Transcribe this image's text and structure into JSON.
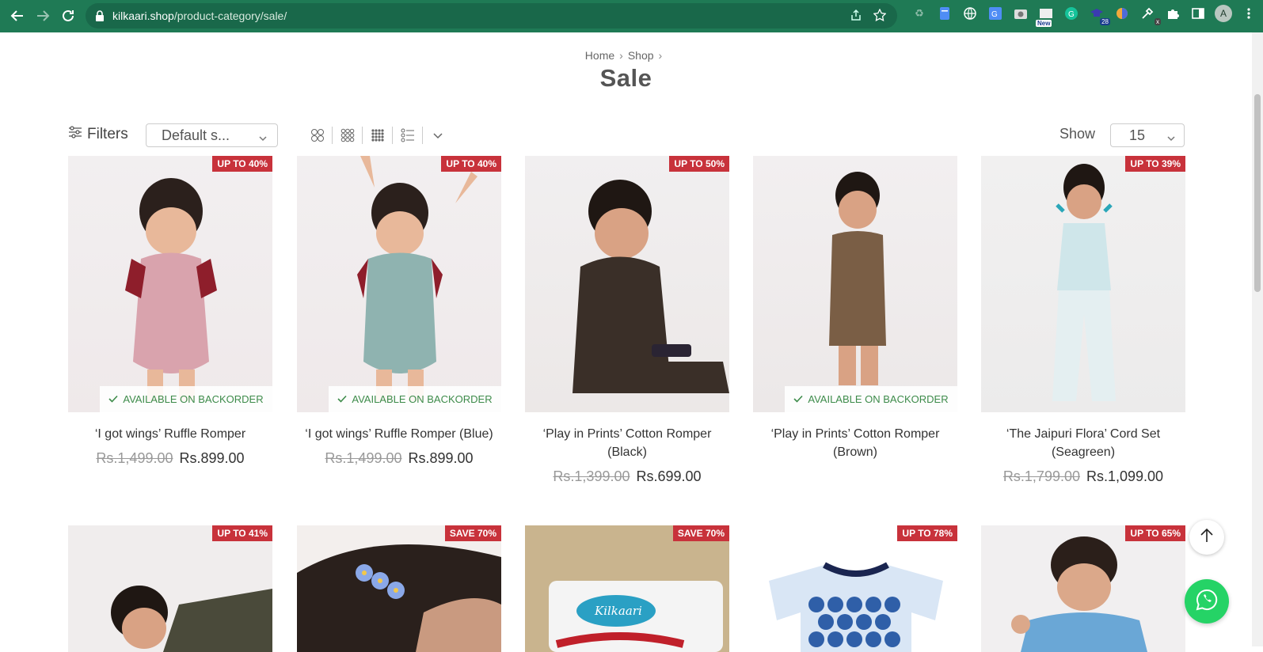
{
  "browser": {
    "url_host": "kilkaari.shop",
    "url_path": "/product-category/sale/",
    "avatar_letter": "A",
    "ext_badge_count": "28",
    "ext_new_label": "New",
    "ext_x_label": "x"
  },
  "breadcrumb": {
    "home": "Home",
    "shop": "Shop"
  },
  "page_title": "Sale",
  "toolbar": {
    "filters_label": "Filters",
    "sort_value": "Default s...",
    "show_label": "Show",
    "show_value": "15"
  },
  "products": [
    {
      "badge": "UP TO 40%",
      "backorder": "AVAILABLE ON BACKORDER",
      "name": "‘I got wings’ Ruffle Romper",
      "old_price": "Rs.1,499.00",
      "new_price": "Rs.899.00",
      "color": "#d9a3ad"
    },
    {
      "badge": "UP TO 40%",
      "backorder": "AVAILABLE ON BACKORDER",
      "name": "‘I got wings’ Ruffle Romper (Blue)",
      "old_price": "Rs.1,499.00",
      "new_price": "Rs.899.00",
      "color": "#8fb3b0"
    },
    {
      "badge": "UP TO 50%",
      "backorder": "",
      "name": "‘Play in Prints’ Cotton Romper (Black)",
      "old_price": "Rs.1,399.00",
      "new_price": "Rs.699.00",
      "color": "#3a2f28"
    },
    {
      "badge": "",
      "backorder": "AVAILABLE ON BACKORDER",
      "name": "‘Play in Prints’ Cotton Romper (Brown)",
      "old_price": "",
      "new_price": "",
      "color": "#7a5e45"
    },
    {
      "badge": "UP TO 39%",
      "backorder": "",
      "name": "‘The Jaipuri Flora’ Cord Set (Seagreen)",
      "old_price": "Rs.1,799.00",
      "new_price": "Rs.1,099.00",
      "color": "#cfe6ea"
    },
    {
      "badge": "UP TO 41%",
      "color": "#4a4a3a"
    },
    {
      "badge": "SAVE 70%",
      "color": "#5a3e34"
    },
    {
      "badge": "SAVE 70%",
      "color": "#c9b48e"
    },
    {
      "badge": "UP TO 78%",
      "color": "#2f5fa8"
    },
    {
      "badge": "UP TO 65%",
      "color": "#6aa7d6"
    }
  ]
}
